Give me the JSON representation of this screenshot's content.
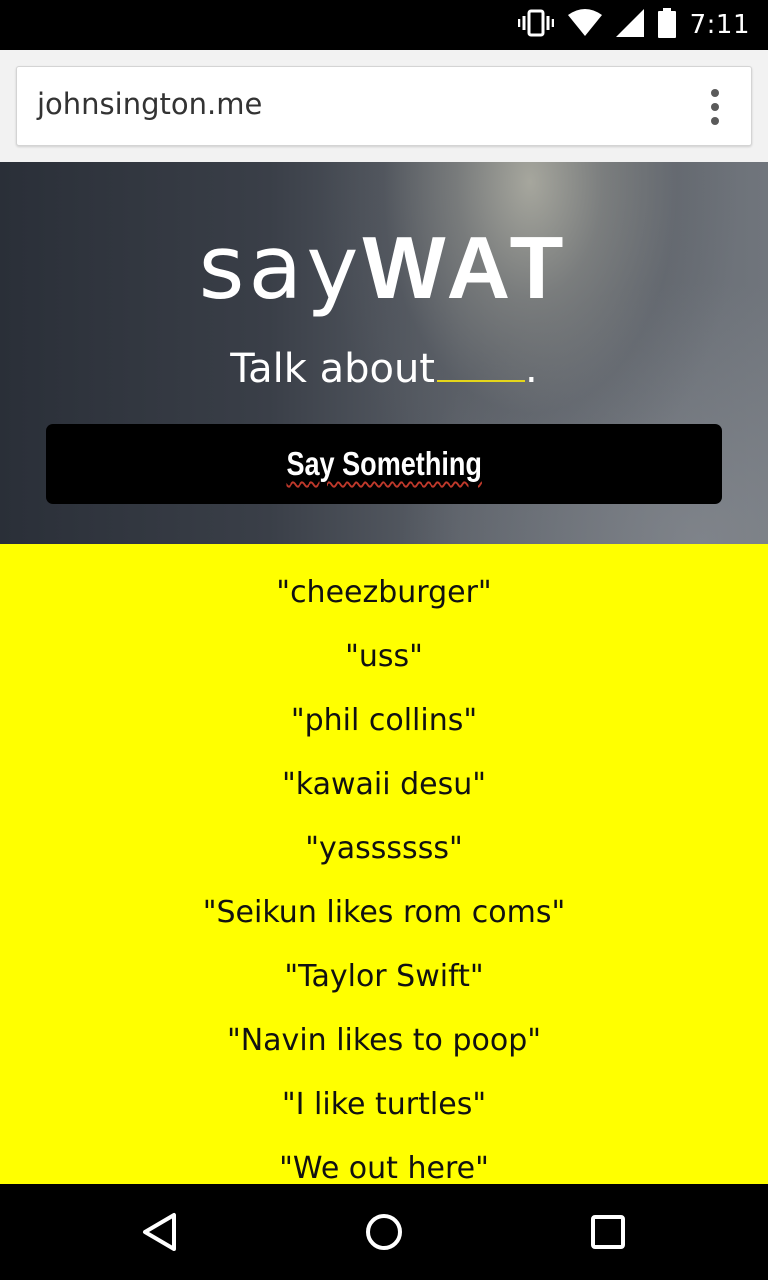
{
  "status_bar": {
    "time": "7:11",
    "icons": [
      "vibrate-icon",
      "wifi-icon",
      "cell-signal-icon",
      "battery-icon"
    ]
  },
  "browser": {
    "url": "johnsington.me",
    "menu_icon": "overflow-menu-icon"
  },
  "hero": {
    "logo_light": "say",
    "logo_bold": "WAT",
    "tagline_prefix": "Talk about",
    "tagline_suffix": ".",
    "button_label": "Say Something",
    "blank_color": "#e5d61a"
  },
  "topics": {
    "background": "#ffff00",
    "items": [
      "\"cheezburger\"",
      "\"uss\"",
      "\"phil collins\"",
      "\"kawaii desu\"",
      "\"yassssss\"",
      "\"Seikun likes rom coms\"",
      "\"Taylor Swift\"",
      "\"Navin likes to poop\"",
      "\"I like turtles\"",
      "\"We out here\""
    ]
  },
  "nav_bar": {
    "buttons": [
      "back-icon",
      "home-icon",
      "recents-icon"
    ]
  }
}
